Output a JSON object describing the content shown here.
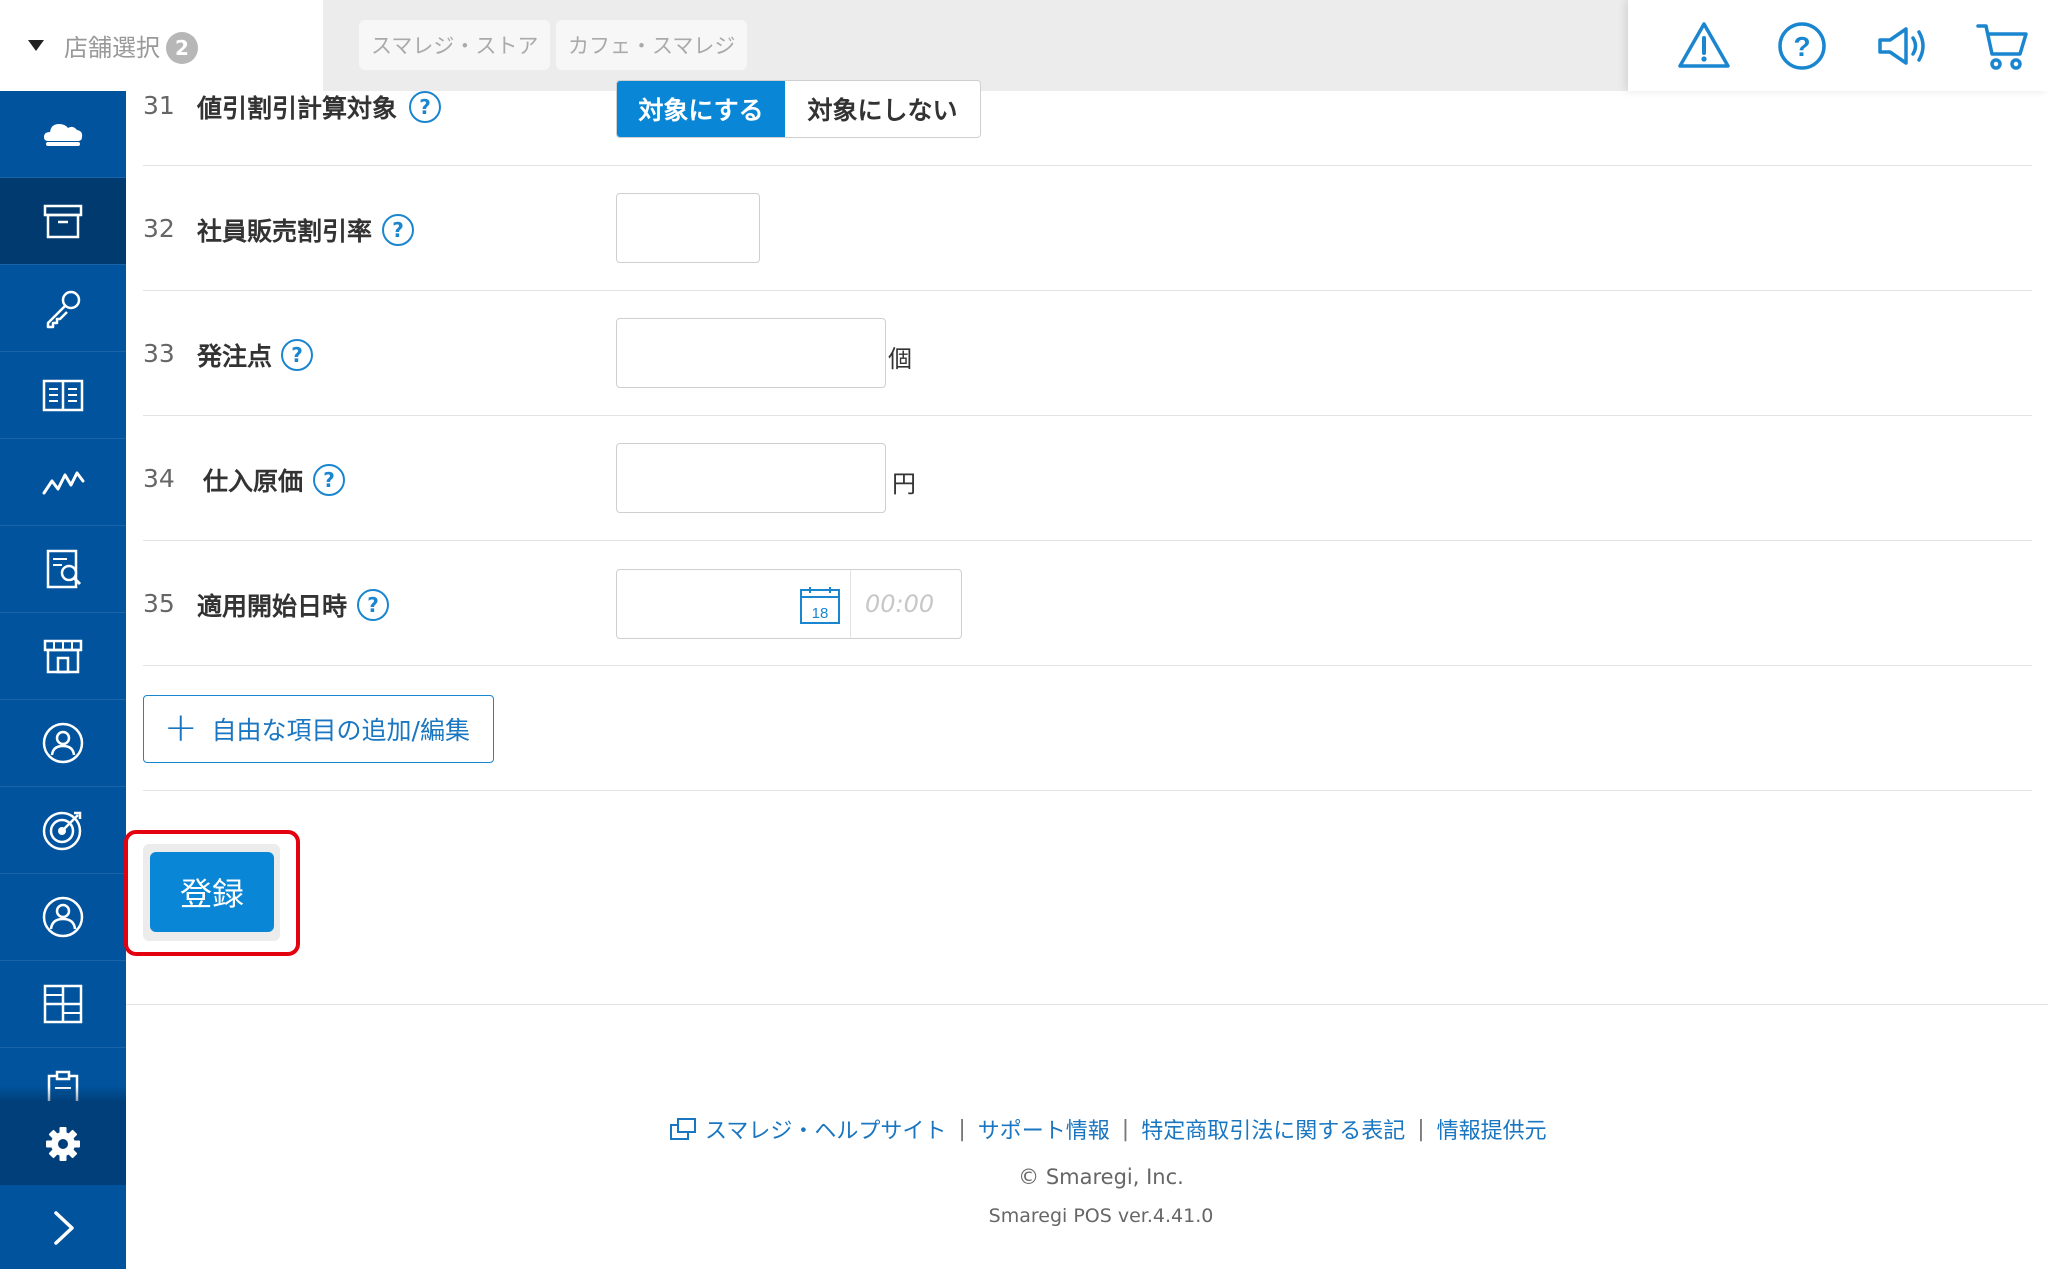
{
  "header": {
    "store_select_label": "店舗選択",
    "store_count": "2",
    "stores": [
      "スマレジ・ストア",
      "カフェ・スマレジ"
    ]
  },
  "top_icons": [
    "warning-icon",
    "help-icon",
    "megaphone-icon",
    "cart-icon"
  ],
  "sidebar": {
    "items": [
      "cloud-icon",
      "box-icon",
      "key-icon",
      "book-icon",
      "chart-line-icon",
      "report-icon",
      "store-icon",
      "customer-icon",
      "target-icon",
      "user-icon",
      "grid-icon",
      "clipboard-icon"
    ],
    "active_item": "box-icon",
    "bottom_items": [
      "gear-icon",
      "chevron-right-icon"
    ]
  },
  "form": {
    "rows": [
      {
        "num": "31",
        "label": "値引割引計算対象",
        "options": [
          "対象にする",
          "対象にしない"
        ],
        "selected": "対象にする"
      },
      {
        "num": "32",
        "label": "社員販売割引率",
        "value": ""
      },
      {
        "num": "33",
        "label": "発注点",
        "value": "",
        "unit": "個"
      },
      {
        "num": "34",
        "label": "仕入原価",
        "value": "",
        "unit": "円"
      },
      {
        "num": "35",
        "label": "適用開始日時",
        "date_value": "",
        "calendar_day": "18",
        "time_placeholder": "00:00"
      }
    ],
    "add_button": "自由な項目の追加/編集",
    "help_mark": "?",
    "save_button": "登録"
  },
  "footer": {
    "links": [
      "スマレジ・ヘルプサイト",
      "サポート情報",
      "特定商取引法に関する表記",
      "情報提供元"
    ],
    "separator": "|",
    "copyright": "© Smaregi, Inc.",
    "version": "Smaregi POS ver.4.41.0"
  },
  "colors": {
    "sidebar": "#00539c",
    "sidebar_active": "#003a6e",
    "accent": "#0a86d6",
    "highlight": "#e3000f"
  }
}
